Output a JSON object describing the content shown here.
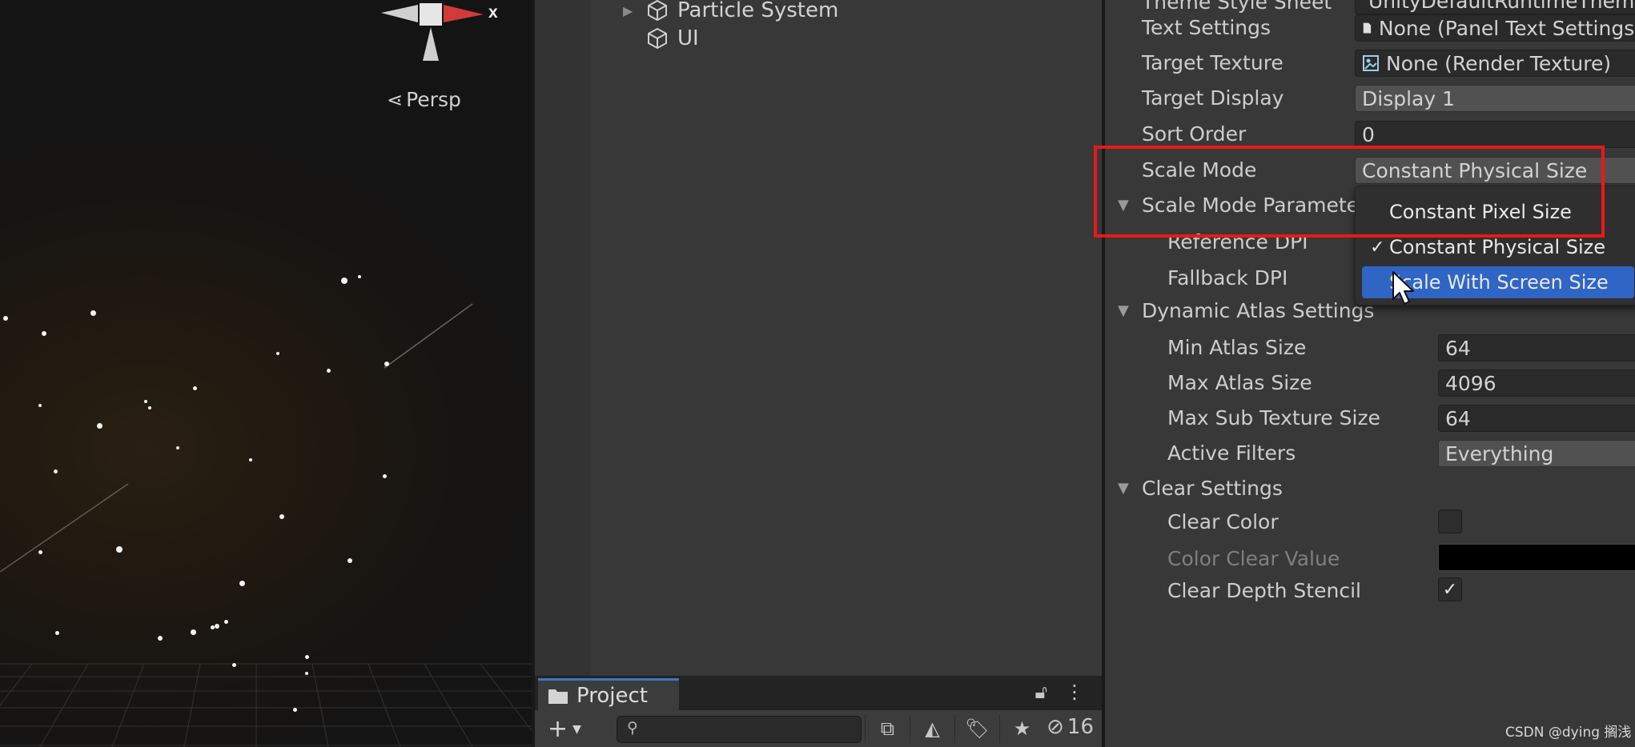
{
  "scene": {
    "gizmo_axis_label": "x",
    "view_mode": "Persp"
  },
  "hierarchy": {
    "items": [
      {
        "label": "Particle System",
        "expandable": true
      },
      {
        "label": "UI",
        "expandable": false
      }
    ]
  },
  "project": {
    "tab_label": "Project",
    "search_placeholder": "",
    "hidden_count": "16"
  },
  "inspector": {
    "rows": {
      "theme_style_sheet": {
        "label": "Theme Style Sheet",
        "value": "UnityDefaultRuntimeTheme"
      },
      "text_settings": {
        "label": "Text Settings",
        "value": "None (Panel Text Settings)"
      },
      "target_texture": {
        "label": "Target Texture",
        "value": "None (Render Texture)"
      },
      "target_display": {
        "label": "Target Display",
        "value": "Display 1"
      },
      "sort_order": {
        "label": "Sort Order",
        "value": "0"
      },
      "scale_mode": {
        "label": "Scale Mode",
        "value": "Constant Physical Size"
      },
      "scale_mode_params": {
        "label": "Scale Mode Parameters"
      },
      "reference_dpi": {
        "label": "Reference DPI"
      },
      "fallback_dpi": {
        "label": "Fallback DPI"
      },
      "dynamic_atlas": {
        "label": "Dynamic Atlas Settings"
      },
      "min_atlas": {
        "label": "Min Atlas Size",
        "value": "64"
      },
      "max_atlas": {
        "label": "Max Atlas Size",
        "value": "4096"
      },
      "max_sub_texture": {
        "label": "Max Sub Texture Size",
        "value": "64"
      },
      "active_filters": {
        "label": "Active Filters",
        "value": "Everything"
      },
      "clear_settings": {
        "label": "Clear Settings"
      },
      "clear_color": {
        "label": "Clear Color",
        "checked": false
      },
      "color_clear_value": {
        "label": "Color Clear Value",
        "color": "#000000"
      },
      "clear_depth_stencil": {
        "label": "Clear Depth Stencil",
        "checked": true
      }
    }
  },
  "scale_mode_dropdown": {
    "options": [
      {
        "label": "Constant Pixel Size",
        "checked": false,
        "hovered": false
      },
      {
        "label": "Constant Physical Size",
        "checked": true,
        "hovered": false
      },
      {
        "label": "Scale With Screen Size",
        "checked": false,
        "hovered": true
      }
    ],
    "check_mark": "✓"
  },
  "colors": {
    "highlight_box": "#e81919",
    "selection_blue": "#2f65c5",
    "tab_accent": "#3a79bb"
  },
  "watermark": "CSDN @dying 搁浅"
}
